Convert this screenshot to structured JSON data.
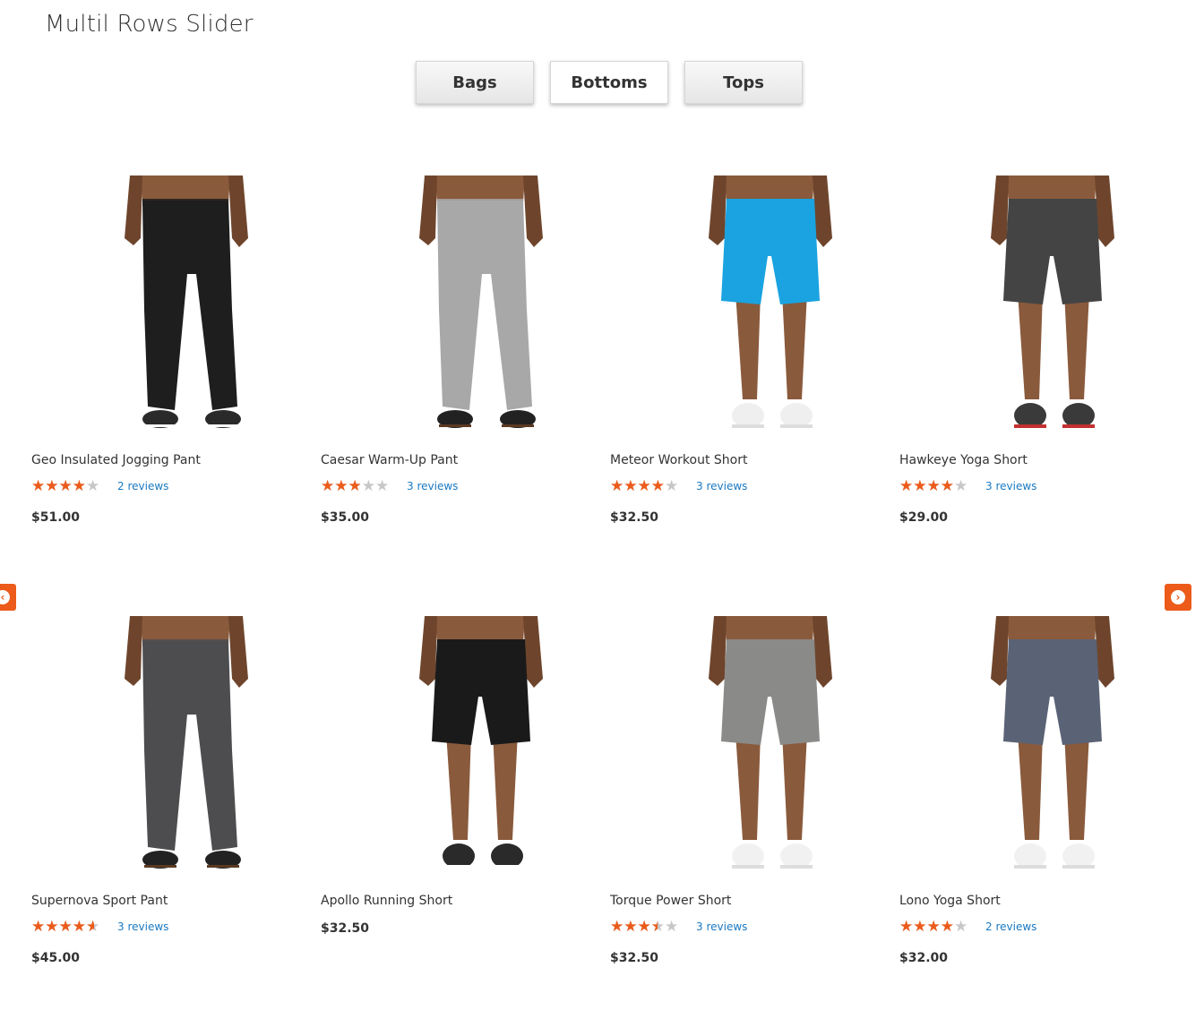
{
  "title": "Multil Rows Slider",
  "tabs": [
    {
      "label": "Bags",
      "active": false
    },
    {
      "label": "Bottoms",
      "active": true
    },
    {
      "label": "Tops",
      "active": false
    }
  ],
  "colors": {
    "accent": "#ec5b1a",
    "link": "#1979c3",
    "star_empty": "#c7c7c7"
  },
  "nav": {
    "prev_icon": "chevron-left-icon",
    "next_icon": "chevron-right-icon"
  },
  "products": [
    {
      "name": "Geo Insulated Jogging Pant",
      "rating_percent": 70,
      "reviews": "2 reviews",
      "price": "$51.00",
      "image": {
        "kind": "pants",
        "garment": "#1e1e1e",
        "shoes": "#2a2a2a",
        "sole": "#ffffff"
      }
    },
    {
      "name": "Caesar Warm-Up Pant",
      "rating_percent": 50,
      "reviews": "3 reviews",
      "price": "$35.00",
      "image": {
        "kind": "pants",
        "garment": "#a8a8a8",
        "shoes": "#222222",
        "sole": "#5a3a22"
      }
    },
    {
      "name": "Meteor Workout Short",
      "rating_percent": 70,
      "reviews": "3 reviews",
      "price": "$32.50",
      "image": {
        "kind": "shorts",
        "garment": "#1aa3e0",
        "shoes": "#efefef",
        "sole": "#dddddd"
      }
    },
    {
      "name": "Hawkeye Yoga Short",
      "rating_percent": 70,
      "reviews": "3 reviews",
      "price": "$29.00",
      "image": {
        "kind": "shorts",
        "garment": "#444444",
        "shoes": "#3a3a3a",
        "sole": "#c23030"
      }
    },
    {
      "name": "Supernova Sport Pant",
      "rating_percent": 80,
      "reviews": "3 reviews",
      "price": "$45.00",
      "image": {
        "kind": "pants",
        "garment": "#4d4d4f",
        "shoes": "#222222",
        "sole": "#5a3a22"
      }
    },
    {
      "name": "Apollo Running Short",
      "rating_percent": null,
      "reviews": "",
      "price": "$32.50",
      "image": {
        "kind": "shorts",
        "garment": "#1a1a1a",
        "shoes": "#2a2a2a",
        "sole": "#ffffff"
      }
    },
    {
      "name": "Torque Power Short",
      "rating_percent": 60,
      "reviews": "3 reviews",
      "price": "$32.50",
      "image": {
        "kind": "shorts",
        "garment": "#8a8a88",
        "shoes": "#f1f1f1",
        "sole": "#dddddd"
      }
    },
    {
      "name": "Lono Yoga Short",
      "rating_percent": 70,
      "reviews": "2 reviews",
      "price": "$32.00",
      "image": {
        "kind": "shorts",
        "garment": "#5a6275",
        "shoes": "#f1f1f1",
        "sole": "#dddddd"
      }
    }
  ]
}
